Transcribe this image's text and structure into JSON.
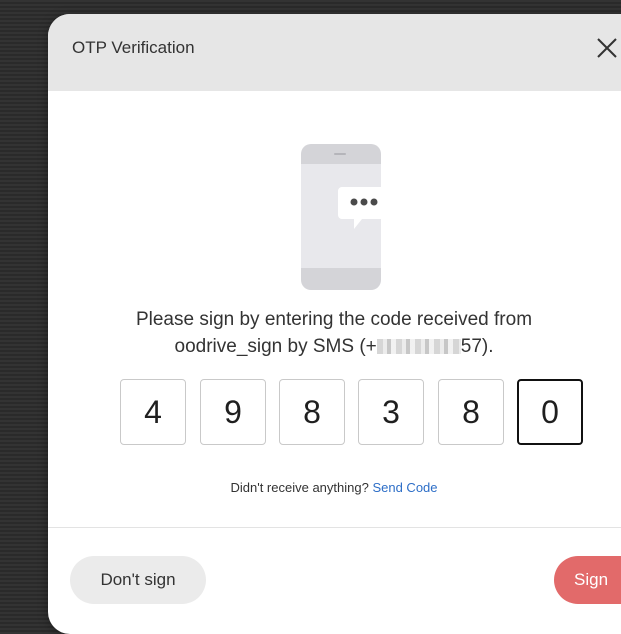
{
  "dialog": {
    "title": "OTP Verification",
    "close_icon": "close-icon"
  },
  "illustration": {
    "icon": "phone-message-icon"
  },
  "prompt": {
    "line1": "Please sign by entering the code received from",
    "line2_prefix": "oodrive_sign by SMS (+",
    "line2_suffix": "57)."
  },
  "otp": {
    "digits": [
      "4",
      "9",
      "8",
      "3",
      "8",
      "0"
    ],
    "active_index": 5
  },
  "resend": {
    "text": "Didn't receive anything?",
    "link": "Send Code"
  },
  "footer": {
    "dont_sign_label": "Don't sign",
    "sign_label": "Sign"
  },
  "colors": {
    "backdrop": "#2f2f2f",
    "header": "#e6e6e6",
    "link": "#2d6ec7",
    "sign_button": "#e26a6a",
    "secondary_button": "#ebebeb"
  }
}
